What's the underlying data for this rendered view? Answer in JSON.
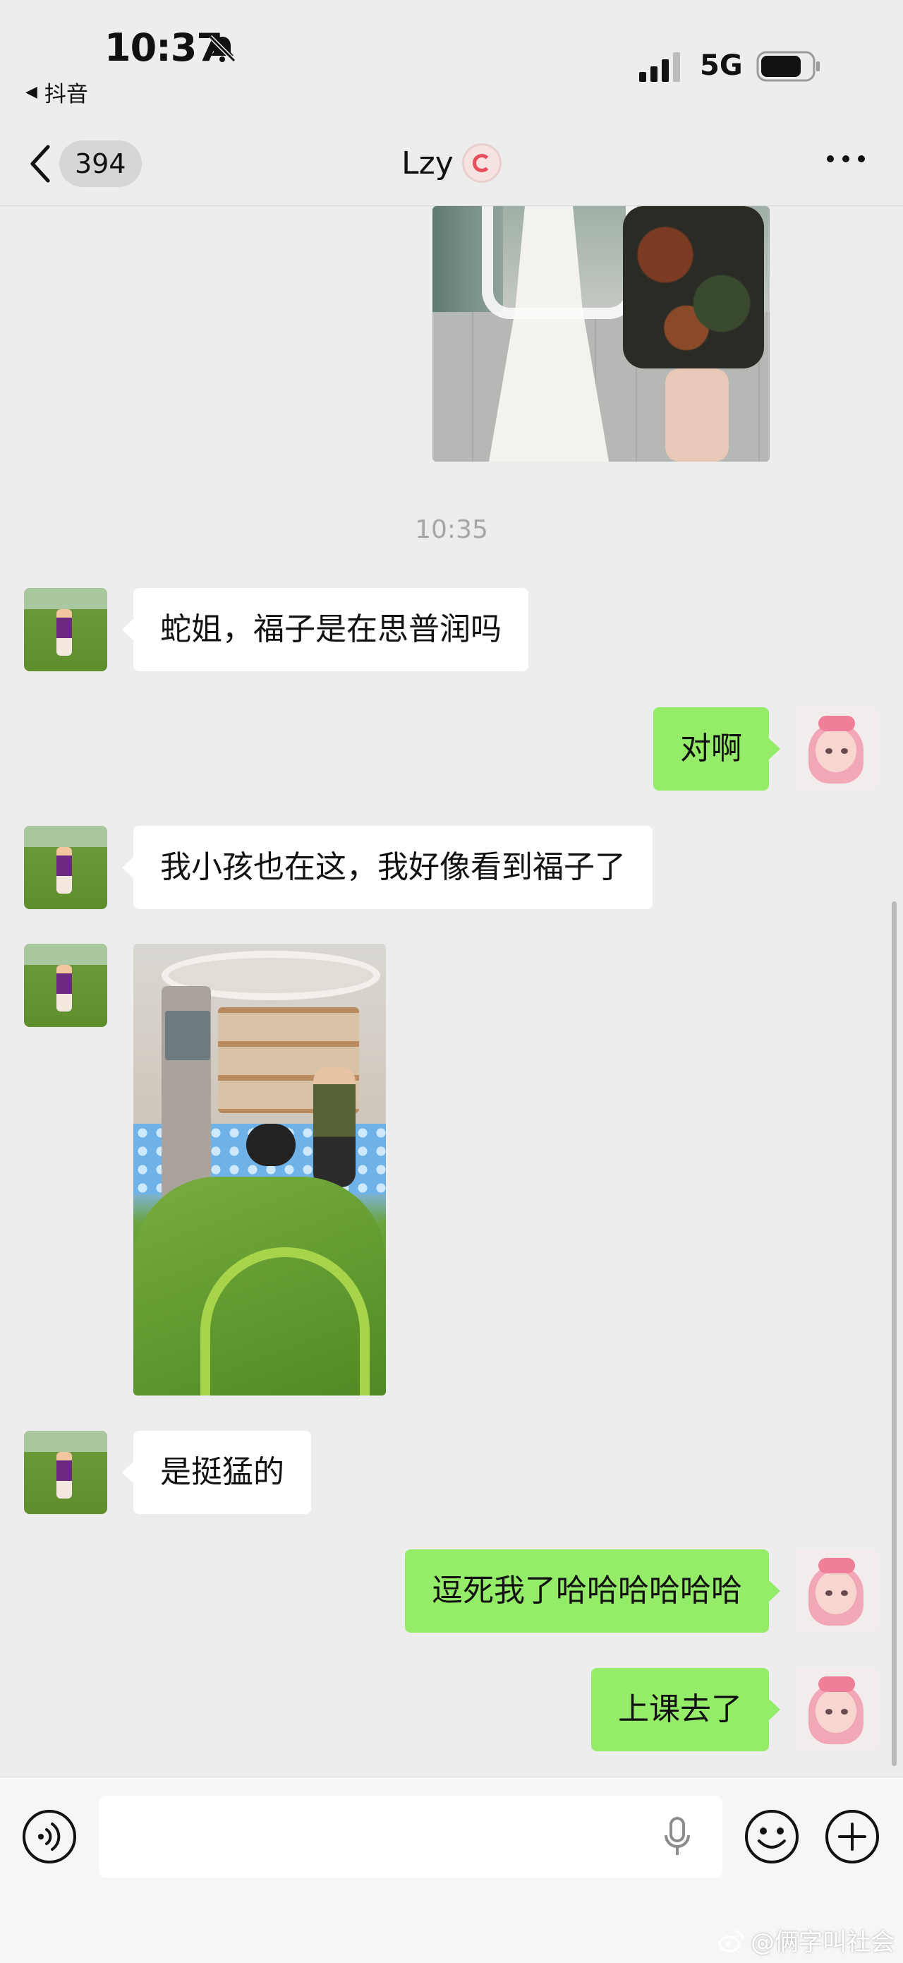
{
  "status_bar": {
    "time": "10:37",
    "back_app": "抖音",
    "network": "5G",
    "battery_level": 0.8
  },
  "nav": {
    "unread_count": "394",
    "title": "Lzy"
  },
  "messages": [
    {
      "type": "timestamp",
      "text": "10:35"
    },
    {
      "side": "left",
      "text": "蛇姐，福子是在思普润吗"
    },
    {
      "side": "right",
      "text": "对啊"
    },
    {
      "side": "left",
      "text": "我小孩也在这，我好像看到福子了"
    },
    {
      "side": "left",
      "type": "image"
    },
    {
      "side": "left",
      "text": "是挺猛的"
    },
    {
      "side": "right",
      "text": "逗死我了哈哈哈哈哈哈"
    },
    {
      "side": "right",
      "text": "上课去了"
    }
  ],
  "watermark": "@俩字叫社会",
  "colors": {
    "background": "#ededed",
    "self_bubble": "#95ec69",
    "other_bubble": "#ffffff",
    "timestamp": "#a6a6a6"
  },
  "icons": [
    "mute-icon",
    "signal-icon",
    "battery-icon",
    "chevron-left-icon",
    "more-icon",
    "voice-icon",
    "mic-icon",
    "emoji-icon",
    "plus-icon",
    "weibo-icon"
  ]
}
